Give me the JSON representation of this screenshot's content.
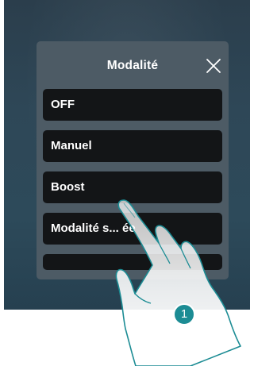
{
  "modal": {
    "title": "Modalité",
    "close_icon": "close-icon"
  },
  "options": [
    {
      "label": "OFF"
    },
    {
      "label": "Manuel"
    },
    {
      "label": "Boost"
    },
    {
      "label": "Modalité s... ée"
    },
    {
      "label": ""
    }
  ],
  "annotation": {
    "step_number": "1",
    "pointer_icon": "hand-pointer-icon"
  },
  "colors": {
    "screen_background": "#2d4757",
    "modal_background": "#4d5b65",
    "option_background": "#131517",
    "text": "#ffffff",
    "badge": "#1c8c94"
  }
}
